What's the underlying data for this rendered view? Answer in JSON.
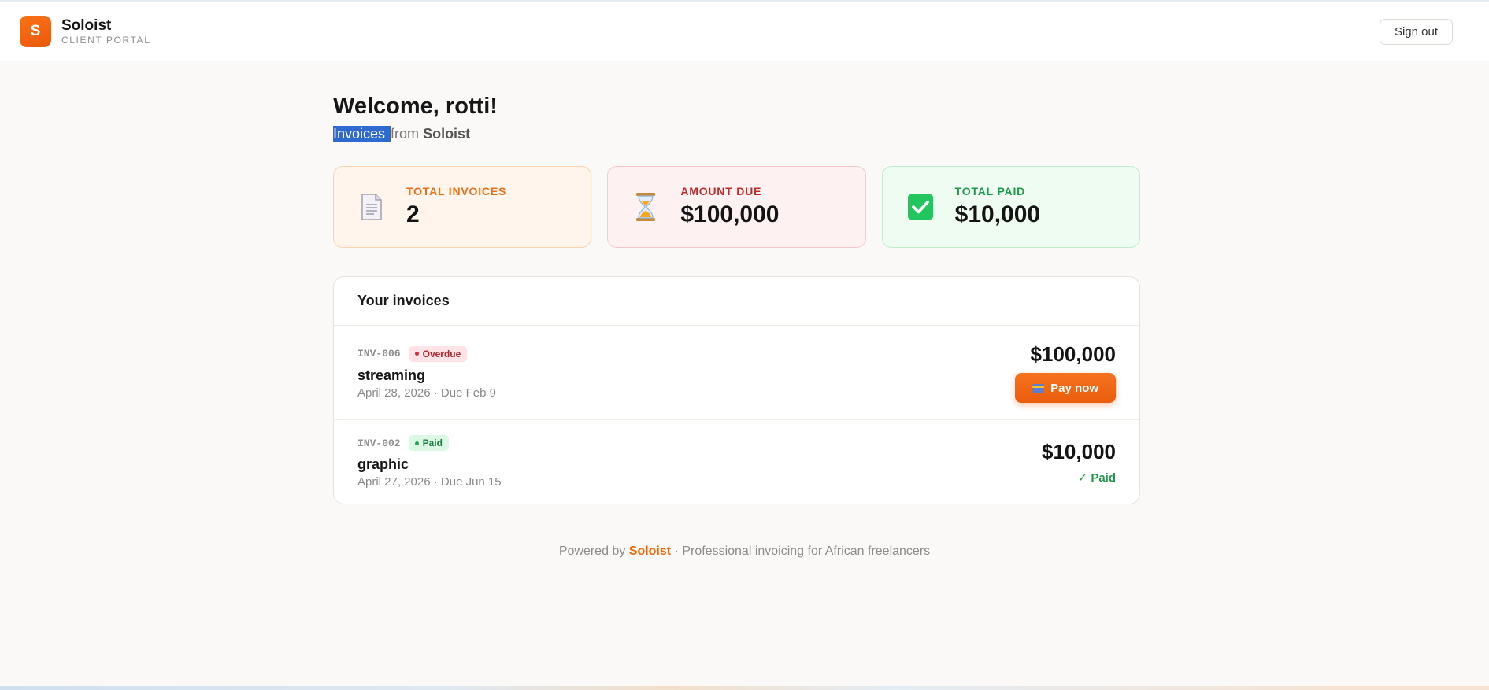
{
  "header": {
    "logo_letter": "S",
    "brand_name": "Soloist",
    "brand_sub": "CLIENT PORTAL",
    "signout_label": "Sign out"
  },
  "welcome": {
    "title": "Welcome, rotti!",
    "sub_highlight": "Invoices ",
    "sub_mid": "from ",
    "sub_brand": "Soloist"
  },
  "stats": [
    {
      "label": "TOTAL INVOICES",
      "value": "2",
      "icon": "document-icon",
      "color": "#e8711c"
    },
    {
      "label": "AMOUNT DUE",
      "value": "$100,000",
      "icon": "hourglass-icon",
      "color": "#c22a2a"
    },
    {
      "label": "TOTAL PAID",
      "value": "$10,000",
      "icon": "check-icon",
      "color": "#1f9a4a"
    }
  ],
  "invoices": {
    "heading": "Your invoices",
    "rows": [
      {
        "id": "INV-006",
        "badge": "Overdue",
        "title": "streaming",
        "date": "April 28, 2026 · Due Feb 9",
        "amount": "$100,000",
        "action": "Pay now"
      },
      {
        "id": "INV-002",
        "badge": "Paid",
        "title": "graphic",
        "date": "April 27, 2026 · Due Jun 15",
        "amount": "$10,000",
        "status": "✓ Paid"
      }
    ]
  },
  "footer": {
    "prefix": "Powered by ",
    "brand": "Soloist",
    "suffix": " · Professional invoicing for African freelancers"
  },
  "colors": {
    "accent": "#ea580c",
    "overdue": "#b3262e",
    "paid": "#1f9a4a"
  }
}
